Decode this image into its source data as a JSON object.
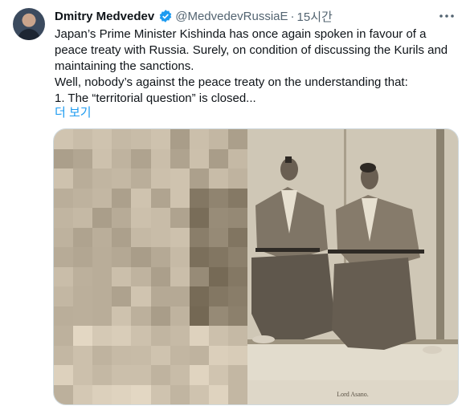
{
  "tweet": {
    "author_name": "Dmitry Medvedev",
    "handle": "@MedvedevRussiaE",
    "separator": "·",
    "time": "15시간",
    "lines": [
      "Japan’s Prime Minister Kishinda has once again spoken in favour of a",
      "peace treaty with Russia. Surely, on condition of discussing the Kurils and",
      "maintaining the sanctions.",
      "Well, nobody’s against the peace treaty on the understanding that:",
      "1. The “territorial question” is closed..."
    ],
    "show_more": "더 보기",
    "photo_caption": "Lord Asano.",
    "colors": {
      "link": "#1d9bf0",
      "verified": "#1d9bf0",
      "secondary_text": "#536471"
    }
  },
  "icons": {
    "verified": "verified-badge-icon",
    "more": "more-options-icon"
  }
}
